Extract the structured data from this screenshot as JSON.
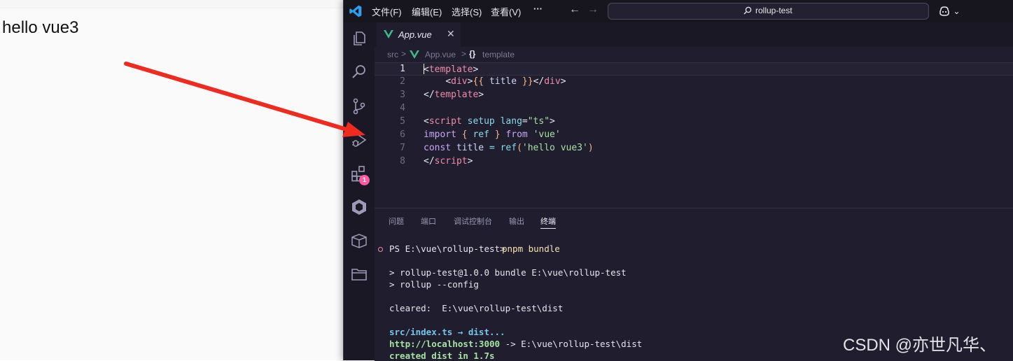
{
  "browser": {
    "content_text": "hello vue3"
  },
  "titlebar": {
    "menus": [
      "文件(F)",
      "编辑(E)",
      "选择(S)",
      "查看(V)",
      "···"
    ],
    "nav_back": "←",
    "nav_forward": "→",
    "search_text": "rollup-test",
    "copilot_chevron": "⌄"
  },
  "activitybar": {
    "icons": [
      "explorer-icon",
      "search-icon",
      "source-control-icon",
      "run-debug-icon",
      "extensions-icon",
      "remote-icon",
      "package-icon",
      "folder-icon"
    ],
    "extensions_badge": "1"
  },
  "editor": {
    "tab_label": "App.vue",
    "tab_close": "✕",
    "breadcrumb": {
      "folder": "src",
      "file": "App.vue",
      "symbol_icon": "{}",
      "symbol": "template",
      "sep": ">"
    },
    "line_numbers": [
      "1",
      "2",
      "3",
      "4",
      "5",
      "6",
      "7",
      "8"
    ],
    "active_line": 1
  },
  "panel": {
    "tabs": [
      "问题",
      "端口",
      "调试控制台",
      "输出",
      "终端"
    ],
    "active_tab": "终端",
    "terminal": {
      "prompt": "PS E:\\vue\\rollup-test> ",
      "command": "pnpm bundle",
      "line_script": "> rollup-test@1.0.0 bundle E:\\vue\\rollup-test",
      "line_rollup": "> rollup --config",
      "line_cleared": "cleared:  E:\\vue\\rollup-test\\dist",
      "line_src": "src/index.ts → dist...",
      "line_server_url": "http://localhost:3000",
      "line_server_rest": " -> E:\\vue\\rollup-test\\dist",
      "line_created": "created dist in 1.7s"
    }
  },
  "watermark": "CSDN @亦世凡华、",
  "colors": {
    "annotation_arrow": "#f02a1f",
    "vue_green": "#41b883",
    "badge": "#ff5aa6"
  }
}
